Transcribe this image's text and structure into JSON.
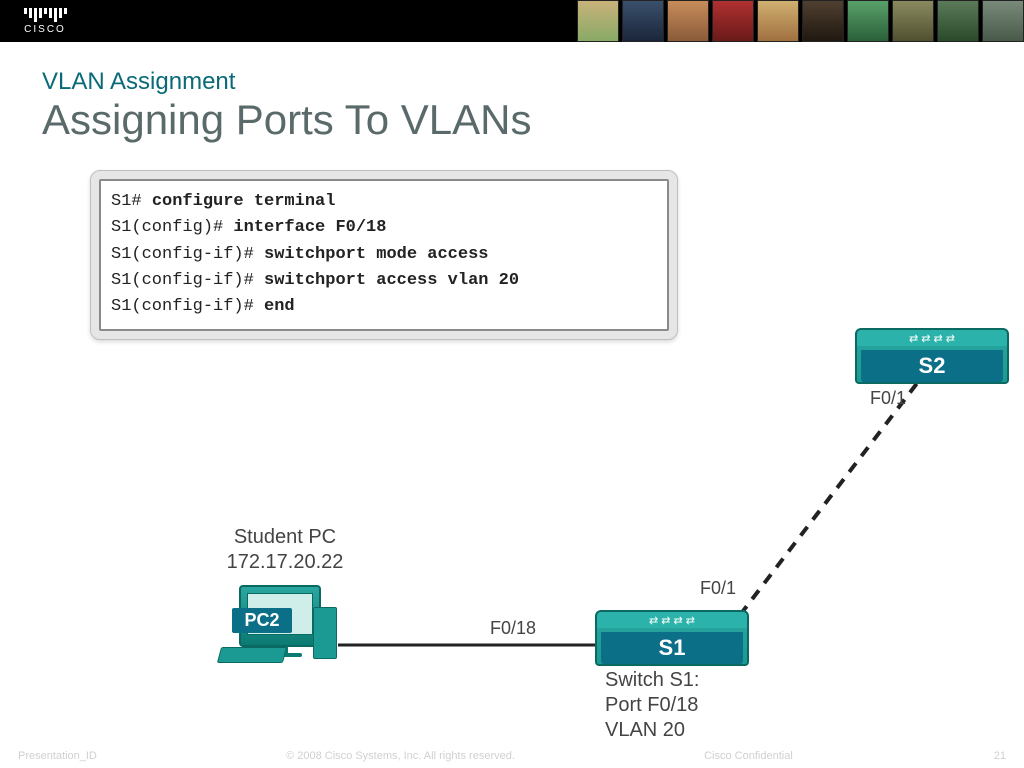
{
  "header": {
    "brand": "cisco"
  },
  "titles": {
    "sub": "VLAN Assignment",
    "main": "Assigning Ports To VLANs"
  },
  "terminal": {
    "lines": [
      {
        "prompt": "S1#",
        "cmd": "configure terminal"
      },
      {
        "prompt": "S1(config)#",
        "cmd": "interface F0/18"
      },
      {
        "prompt": "S1(config-if)#",
        "cmd": "switchport mode access"
      },
      {
        "prompt": "S1(config-if)#",
        "cmd": "switchport access vlan 20"
      },
      {
        "prompt": "S1(config-if)#",
        "cmd": "end"
      }
    ]
  },
  "diagram": {
    "pc": {
      "label": "PC2",
      "caption_line1": "Student PC",
      "caption_line2": "172.17.20.22"
    },
    "s1": {
      "label": "S1",
      "caption_line1": "Switch S1:",
      "caption_line2": "Port F0/18",
      "caption_line3": "VLAN 20"
    },
    "s2": {
      "label": "S2"
    },
    "ports": {
      "pc_to_s1": "F0/18",
      "s1_up": "F0/1",
      "s2_down": "F0/1"
    }
  },
  "footer": {
    "left": "Presentation_ID",
    "center": "© 2008 Cisco Systems, Inc. All rights reserved.",
    "right": "Cisco Confidential",
    "page": "21"
  }
}
